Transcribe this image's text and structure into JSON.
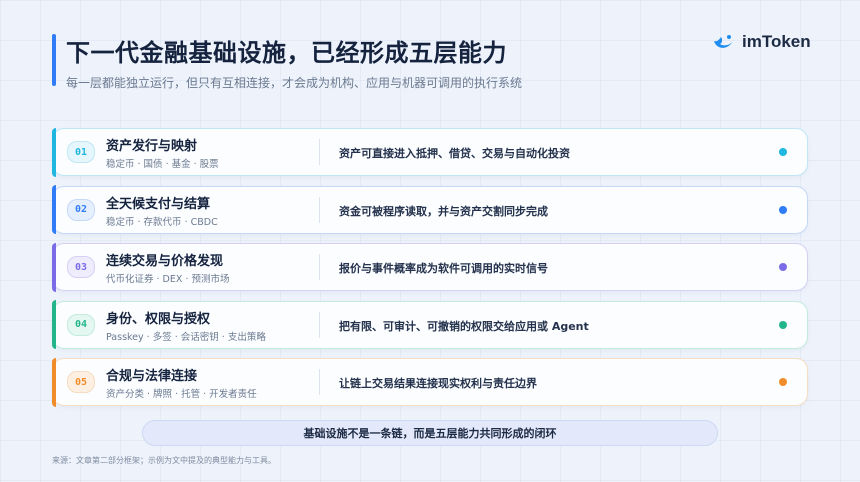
{
  "header": {
    "title": "下一代金融基础设施，已经形成五层能力",
    "subtitle": "每一层都能独立运行，但只有互相连接，才会成为机构、应用与机器可调用的执行系统",
    "logo_text": "imToken"
  },
  "layers": [
    {
      "num": "01",
      "title": "资产发行与映射",
      "tags": "稳定币 · 国债 · 基金 · 股票",
      "desc": "资产可直接进入抵押、借贷、交易与自动化投资",
      "color": "#1fb6e0",
      "border": "#bfe7f4",
      "badge_bg": "#e5f6fc"
    },
    {
      "num": "02",
      "title": "全天候支付与结算",
      "tags": "稳定币 · 存款代币 · CBDC",
      "desc": "资金可被程序读取，并与资产交割同步完成",
      "color": "#2f7cf6",
      "border": "#c4d8f8",
      "badge_bg": "#e6effd"
    },
    {
      "num": "03",
      "title": "连续交易与价格发现",
      "tags": "代币化证券 · DEX · 预测市场",
      "desc": "报价与事件概率成为软件可调用的实时信号",
      "color": "#7b6be6",
      "border": "#d6d0f5",
      "badge_bg": "#efecfc"
    },
    {
      "num": "04",
      "title": "身份、权限与授权",
      "tags": "Passkey · 多签 · 会话密钥 · 支出策略",
      "desc": "把有限、可审计、可撤销的权限交给应用或 Agent",
      "color": "#22b58b",
      "border": "#c3ebdd",
      "badge_bg": "#e4f7f0"
    },
    {
      "num": "05",
      "title": "合规与法律连接",
      "tags": "资产分类 · 牌照 · 托管 · 开发者责任",
      "desc": "让链上交易结果连接现实权利与责任边界",
      "color": "#f08c2a",
      "border": "#f6dcc0",
      "badge_bg": "#fdf0e2"
    }
  ],
  "footer": {
    "summary": "基础设施不是一条链，而是五层能力共同形成的闭环",
    "source": "来源：文章第二部分框架；示例为文中提及的典型能力与工具。"
  }
}
